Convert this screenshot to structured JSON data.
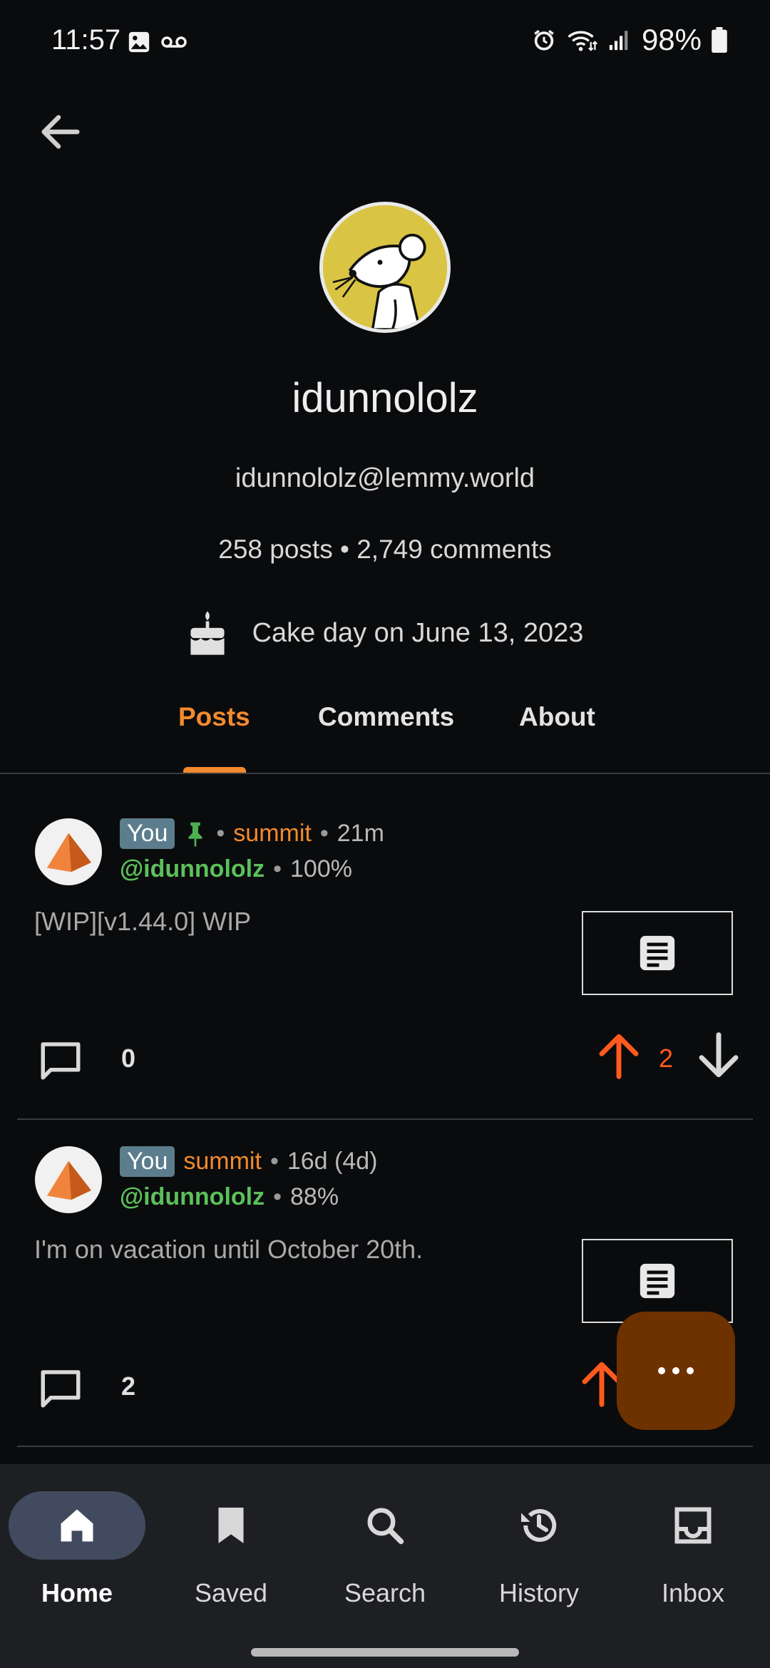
{
  "status_bar": {
    "time": "11:57",
    "battery": "98%"
  },
  "profile": {
    "display_name": "idunnololz",
    "handle": "idunnololz@lemmy.world",
    "stats": "258 posts • 2,749 comments",
    "cake_day": "Cake day on June 13, 2023"
  },
  "tabs": [
    {
      "label": "Posts",
      "active": true
    },
    {
      "label": "Comments",
      "active": false
    },
    {
      "label": "About",
      "active": false
    }
  ],
  "posts": [
    {
      "badge": "You",
      "pinned": true,
      "community": "summit",
      "age": "21m",
      "author": "@idunnololz",
      "ratio": "100%",
      "title": "[WIP][v1.44.0] WIP",
      "comments": "0",
      "score": "2"
    },
    {
      "badge": "You",
      "pinned": false,
      "community": "summit",
      "age": "16d (4d)",
      "author": "@idunnololz",
      "ratio": "88%",
      "title": "I'm on vacation until October 20th.",
      "comments": "2",
      "score": ""
    }
  ],
  "nav": [
    {
      "label": "Home",
      "icon": "home-icon",
      "active": true
    },
    {
      "label": "Saved",
      "icon": "bookmark-icon",
      "active": false
    },
    {
      "label": "Search",
      "icon": "search-icon",
      "active": false
    },
    {
      "label": "History",
      "icon": "history-icon",
      "active": false
    },
    {
      "label": "Inbox",
      "icon": "inbox-icon",
      "active": false
    }
  ],
  "colors": {
    "accent": "#f28a2e",
    "author": "#5bc15b",
    "upvote": "#ff5a1f",
    "fab": "#6e3100"
  }
}
